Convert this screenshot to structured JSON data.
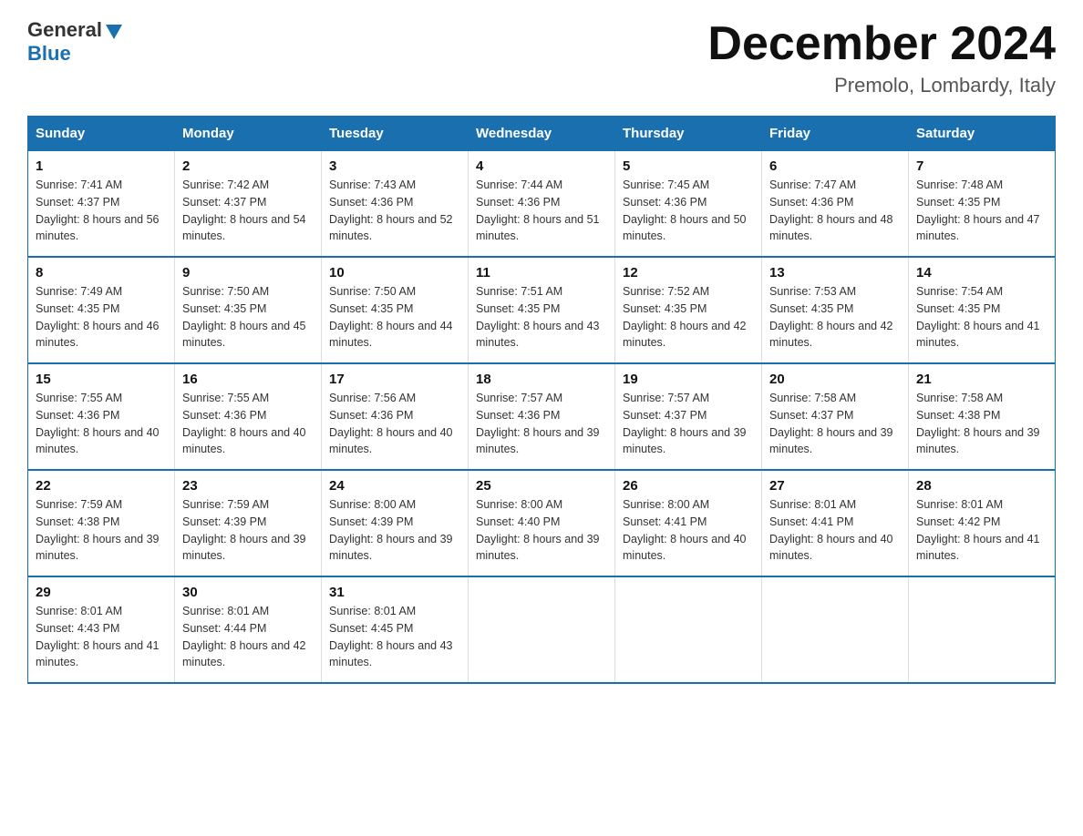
{
  "header": {
    "logo_general": "General",
    "logo_blue": "Blue",
    "month_title": "December 2024",
    "location": "Premolo, Lombardy, Italy"
  },
  "days_of_week": [
    "Sunday",
    "Monday",
    "Tuesday",
    "Wednesday",
    "Thursday",
    "Friday",
    "Saturday"
  ],
  "weeks": [
    [
      {
        "day": "1",
        "sunrise": "7:41 AM",
        "sunset": "4:37 PM",
        "daylight": "8 hours and 56 minutes."
      },
      {
        "day": "2",
        "sunrise": "7:42 AM",
        "sunset": "4:37 PM",
        "daylight": "8 hours and 54 minutes."
      },
      {
        "day": "3",
        "sunrise": "7:43 AM",
        "sunset": "4:36 PM",
        "daylight": "8 hours and 52 minutes."
      },
      {
        "day": "4",
        "sunrise": "7:44 AM",
        "sunset": "4:36 PM",
        "daylight": "8 hours and 51 minutes."
      },
      {
        "day": "5",
        "sunrise": "7:45 AM",
        "sunset": "4:36 PM",
        "daylight": "8 hours and 50 minutes."
      },
      {
        "day": "6",
        "sunrise": "7:47 AM",
        "sunset": "4:36 PM",
        "daylight": "8 hours and 48 minutes."
      },
      {
        "day": "7",
        "sunrise": "7:48 AM",
        "sunset": "4:35 PM",
        "daylight": "8 hours and 47 minutes."
      }
    ],
    [
      {
        "day": "8",
        "sunrise": "7:49 AM",
        "sunset": "4:35 PM",
        "daylight": "8 hours and 46 minutes."
      },
      {
        "day": "9",
        "sunrise": "7:50 AM",
        "sunset": "4:35 PM",
        "daylight": "8 hours and 45 minutes."
      },
      {
        "day": "10",
        "sunrise": "7:50 AM",
        "sunset": "4:35 PM",
        "daylight": "8 hours and 44 minutes."
      },
      {
        "day": "11",
        "sunrise": "7:51 AM",
        "sunset": "4:35 PM",
        "daylight": "8 hours and 43 minutes."
      },
      {
        "day": "12",
        "sunrise": "7:52 AM",
        "sunset": "4:35 PM",
        "daylight": "8 hours and 42 minutes."
      },
      {
        "day": "13",
        "sunrise": "7:53 AM",
        "sunset": "4:35 PM",
        "daylight": "8 hours and 42 minutes."
      },
      {
        "day": "14",
        "sunrise": "7:54 AM",
        "sunset": "4:35 PM",
        "daylight": "8 hours and 41 minutes."
      }
    ],
    [
      {
        "day": "15",
        "sunrise": "7:55 AM",
        "sunset": "4:36 PM",
        "daylight": "8 hours and 40 minutes."
      },
      {
        "day": "16",
        "sunrise": "7:55 AM",
        "sunset": "4:36 PM",
        "daylight": "8 hours and 40 minutes."
      },
      {
        "day": "17",
        "sunrise": "7:56 AM",
        "sunset": "4:36 PM",
        "daylight": "8 hours and 40 minutes."
      },
      {
        "day": "18",
        "sunrise": "7:57 AM",
        "sunset": "4:36 PM",
        "daylight": "8 hours and 39 minutes."
      },
      {
        "day": "19",
        "sunrise": "7:57 AM",
        "sunset": "4:37 PM",
        "daylight": "8 hours and 39 minutes."
      },
      {
        "day": "20",
        "sunrise": "7:58 AM",
        "sunset": "4:37 PM",
        "daylight": "8 hours and 39 minutes."
      },
      {
        "day": "21",
        "sunrise": "7:58 AM",
        "sunset": "4:38 PM",
        "daylight": "8 hours and 39 minutes."
      }
    ],
    [
      {
        "day": "22",
        "sunrise": "7:59 AM",
        "sunset": "4:38 PM",
        "daylight": "8 hours and 39 minutes."
      },
      {
        "day": "23",
        "sunrise": "7:59 AM",
        "sunset": "4:39 PM",
        "daylight": "8 hours and 39 minutes."
      },
      {
        "day": "24",
        "sunrise": "8:00 AM",
        "sunset": "4:39 PM",
        "daylight": "8 hours and 39 minutes."
      },
      {
        "day": "25",
        "sunrise": "8:00 AM",
        "sunset": "4:40 PM",
        "daylight": "8 hours and 39 minutes."
      },
      {
        "day": "26",
        "sunrise": "8:00 AM",
        "sunset": "4:41 PM",
        "daylight": "8 hours and 40 minutes."
      },
      {
        "day": "27",
        "sunrise": "8:01 AM",
        "sunset": "4:41 PM",
        "daylight": "8 hours and 40 minutes."
      },
      {
        "day": "28",
        "sunrise": "8:01 AM",
        "sunset": "4:42 PM",
        "daylight": "8 hours and 41 minutes."
      }
    ],
    [
      {
        "day": "29",
        "sunrise": "8:01 AM",
        "sunset": "4:43 PM",
        "daylight": "8 hours and 41 minutes."
      },
      {
        "day": "30",
        "sunrise": "8:01 AM",
        "sunset": "4:44 PM",
        "daylight": "8 hours and 42 minutes."
      },
      {
        "day": "31",
        "sunrise": "8:01 AM",
        "sunset": "4:45 PM",
        "daylight": "8 hours and 43 minutes."
      },
      null,
      null,
      null,
      null
    ]
  ]
}
